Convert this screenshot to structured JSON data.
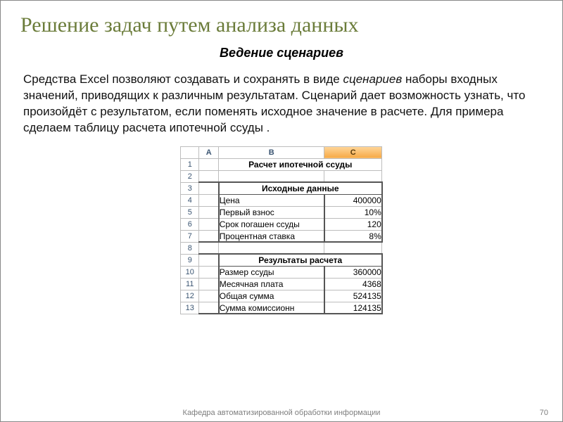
{
  "title": "Решение задач путем анализа данных",
  "subtitle": "Ведение сценариев",
  "body_pre": "Средства Excel позволяют создавать и сохранять в виде ",
  "body_ital": "сценариев",
  "body_post": " наборы входных значений, приводящих к различным результатам. Сценарий дает возможность узнать, что произойдёт с результатом, если поменять исходное значение в расчете. Для примера сделаем таблицу расчета ипотечной ссуды .",
  "excel": {
    "col_headers": [
      "A",
      "B",
      "C"
    ],
    "selected_col": 2,
    "row_count": 13,
    "row1_title": "Расчет ипотечной ссуды",
    "row3_title": "Исходные данные",
    "row9_title": "Результаты расчета",
    "rows": {
      "4": {
        "label": "Цена",
        "value": "400000"
      },
      "5": {
        "label": "Первый взнос",
        "value": "10%"
      },
      "6": {
        "label": "Срок погашен ссуды",
        "value": "120"
      },
      "7": {
        "label": "Процентная ставка",
        "value": "8%"
      },
      "10": {
        "label": "Размер ссуды",
        "value": "360000"
      },
      "11": {
        "label": "Месячная плата",
        "value": "4368"
      },
      "12": {
        "label": "Общая сумма",
        "value": "524135"
      },
      "13": {
        "label": "Сумма  комиссионн",
        "value": "124135"
      }
    }
  },
  "footer": "Кафедра автоматизированной обработки информации",
  "page": "70"
}
